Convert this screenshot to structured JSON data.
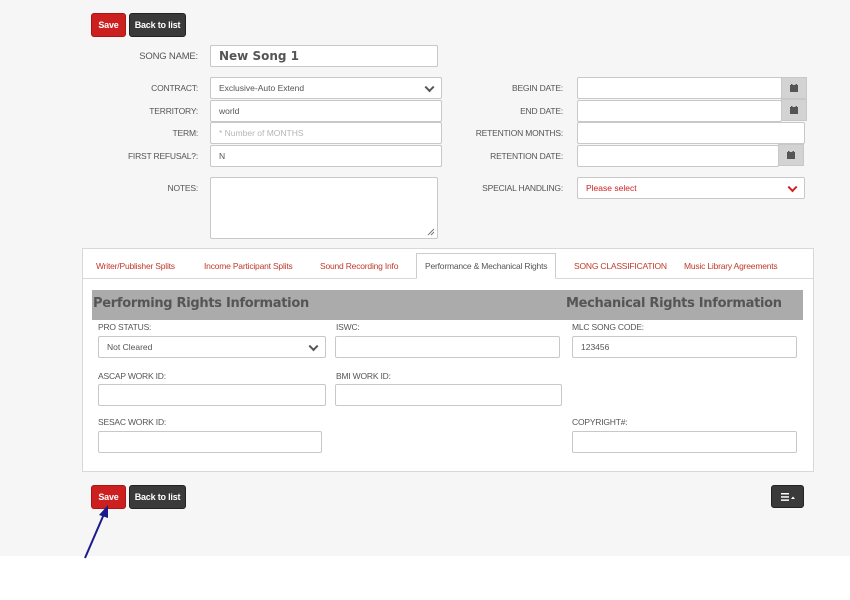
{
  "toolbar": {
    "save_label": "Save",
    "back_label": "Back to list"
  },
  "song": {
    "name_label": "SONG NAME:",
    "name_value": "New Song 1"
  },
  "form": {
    "contract_label": "CONTRACT:",
    "contract_value": "Exclusive-Auto Extend",
    "territory_label": "TERRITORY:",
    "territory_value": "world",
    "term_label": "TERM:",
    "term_placeholder": "* Number of MONTHS",
    "first_refusal_label": "FIRST REFUSAL?:",
    "first_refusal_value": "N",
    "notes_label": "NOTES:",
    "begin_date_label": "BEGIN DATE:",
    "end_date_label": "END DATE:",
    "retention_months_label": "RETENTION MONTHS:",
    "retention_date_label": "RETENTION DATE:",
    "special_handling_label": "SPECIAL HANDLING:",
    "special_handling_value": "Please select"
  },
  "tabs": [
    {
      "label": "Writer/Publisher Splits",
      "active": false
    },
    {
      "label": "Income Participant Splits",
      "active": false
    },
    {
      "label": "Sound Recording Info",
      "active": false
    },
    {
      "label": "Performance & Mechanical Rights",
      "active": true
    },
    {
      "label": "SONG CLASSIFICATION",
      "active": false
    },
    {
      "label": "Music Library Agreements",
      "active": false
    }
  ],
  "rights": {
    "performing_title": "Performing Rights Information",
    "mechanical_title": "Mechanical Rights Information",
    "pro_status_label": "PRO STATUS:",
    "pro_status_value": "Not Cleared",
    "iswc_label": "ISWC:",
    "mlc_label": "MLC SONG CODE:",
    "mlc_value": "123456",
    "ascap_label": "ASCAP WORK ID:",
    "bmi_label": "BMI WORK ID:",
    "sesac_label": "SESAC WORK ID:",
    "copyright_label": "COPYRIGHT#:"
  },
  "colors": {
    "accent_red": "#cc1f1f",
    "dark_button": "#3a3a3a",
    "tab_text": "#c0392b",
    "annotation_arrow": "#1a1a8c"
  },
  "icons": {
    "calendar": "calendar-icon",
    "menu": "menu-icon",
    "dropdown": "chevron-down-icon"
  }
}
